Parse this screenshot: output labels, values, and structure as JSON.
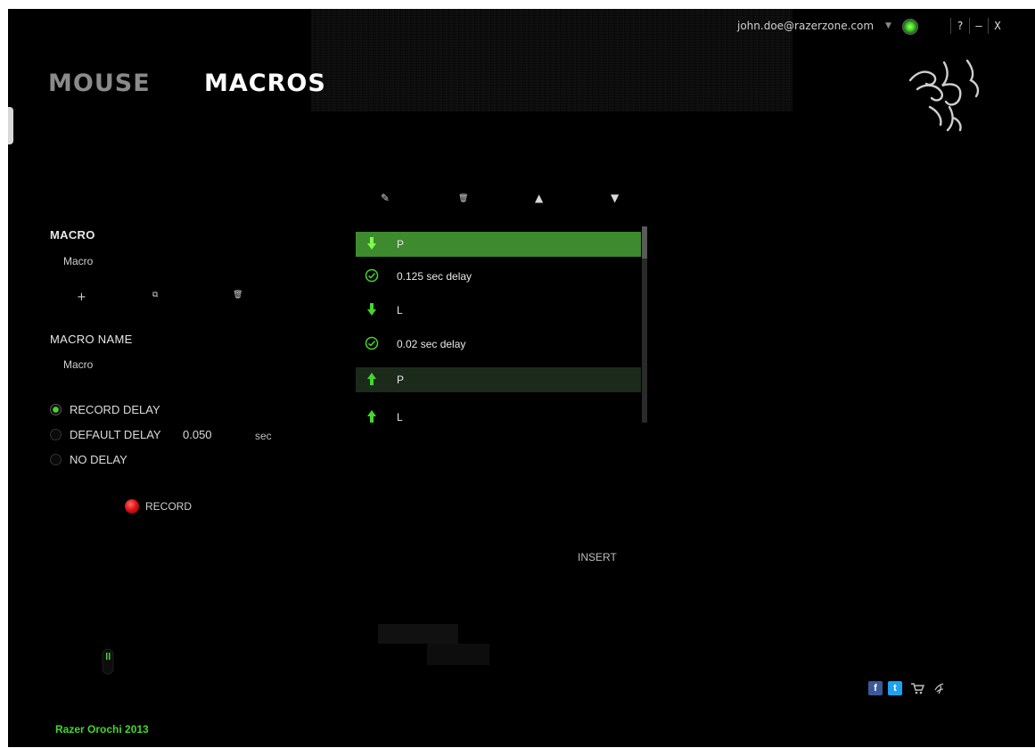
{
  "header": {
    "user_email": "john.doe@razerzone.com",
    "dropdown_caret": "▼",
    "status_color": "#44d62c",
    "window_buttons": [
      "?",
      "–",
      "X"
    ]
  },
  "tabs": [
    {
      "label": "MOUSE",
      "active": false
    },
    {
      "label": "MACROS",
      "active": true
    }
  ],
  "sidebar": {
    "macro_heading": "MACRO",
    "macro_value": "Macro",
    "macro_actions": [
      {
        "name": "add",
        "glyph": "+"
      },
      {
        "name": "copy",
        "glyph": "⧉"
      },
      {
        "name": "delete",
        "glyph": "🗑"
      }
    ],
    "macro_name_heading": "MACRO NAME",
    "macro_name_value": "Macro",
    "delay_options": [
      {
        "label": "RECORD DELAY",
        "selected": true
      },
      {
        "label": "DEFAULT DELAY",
        "selected": false
      },
      {
        "label": "NO DELAY",
        "selected": false
      }
    ],
    "default_delay_value": "0.050",
    "default_delay_unit": "sec",
    "record_label": "RECORD"
  },
  "editor": {
    "toolbar": [
      {
        "name": "edit",
        "glyph": "✎"
      },
      {
        "name": "delete",
        "glyph": "🗑"
      },
      {
        "name": "move-up",
        "glyph": "▲"
      },
      {
        "name": "move-down",
        "glyph": "▼"
      }
    ],
    "rows": [
      {
        "icon": "key-down-arrow-icon",
        "label": "P",
        "state": "selected"
      },
      {
        "icon": "clock-icon",
        "label": "0.125 sec delay",
        "state": "normal"
      },
      {
        "icon": "key-down-arrow-icon",
        "label": "L",
        "state": "normal"
      },
      {
        "icon": "clock-icon",
        "label": "0.02 sec delay",
        "state": "normal"
      },
      {
        "icon": "key-up-arrow-icon",
        "label": "P",
        "state": "highlighted"
      },
      {
        "icon": "key-up-arrow-icon",
        "label": "L",
        "state": "normal"
      }
    ],
    "insert_label": "INSERT"
  },
  "footer": {
    "device_name": "Razer Orochi 2013",
    "social_icons": [
      "facebook-icon",
      "twitter-icon",
      "cart-icon",
      "razer-icon"
    ]
  },
  "colors": {
    "accent": "#44d62c",
    "background": "#000000",
    "selected_row": "#3e8a2e",
    "record": "#e01414"
  }
}
